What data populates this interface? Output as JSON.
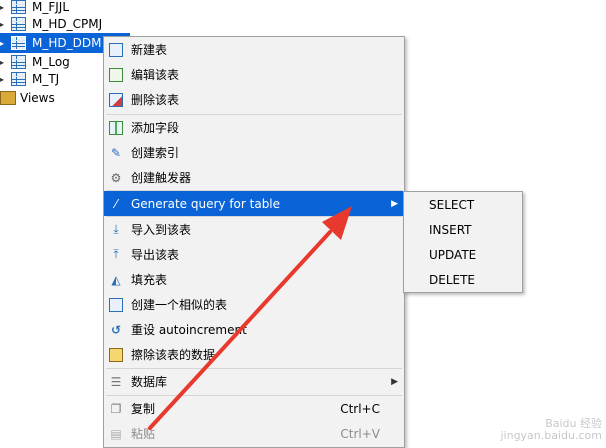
{
  "tree": {
    "items": [
      {
        "label": "M_FJJL",
        "selected": false
      },
      {
        "label": "M_HD_CPMJ",
        "selected": false
      },
      {
        "label": "M_HD_DDM",
        "selected": true
      },
      {
        "label": "M_Log",
        "selected": false
      },
      {
        "label": "M_TJ",
        "selected": false
      }
    ],
    "views_label": "Views"
  },
  "context_menu": {
    "new_table": "新建表",
    "edit_table": "编辑该表",
    "delete_table": "删除该表",
    "add_field": "添加字段",
    "create_index": "创建索引",
    "create_trigger": "创建触发器",
    "generate_query": "Generate query for table",
    "import_table": "导入到该表",
    "export_table": "导出该表",
    "fill_table": "填充表",
    "create_similar": "创建一个相似的表",
    "reset_autoincrement": "重设 autoincrement",
    "clear_data": "擦除该表的数据",
    "database": "数据库",
    "copy": "复制",
    "copy_shortcut": "Ctrl+C",
    "paste": "粘贴",
    "paste_shortcut": "Ctrl+V"
  },
  "submenu": {
    "items": [
      "SELECT",
      "INSERT",
      "UPDATE",
      "DELETE"
    ]
  },
  "watermark": {
    "line1": "Baidu 经验",
    "line2": "jingyan.baidu.com"
  },
  "colors": {
    "selection": "#0a64d8",
    "menu_bg": "#f2f2f2",
    "arrow": "#e8392f"
  }
}
